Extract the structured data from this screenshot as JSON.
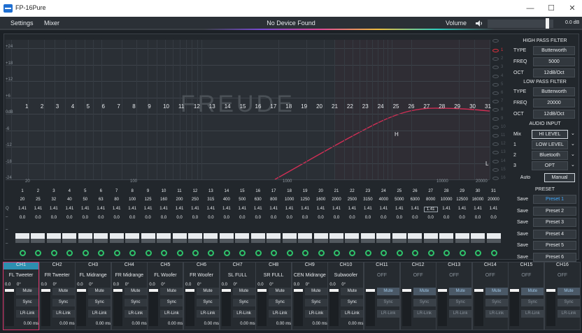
{
  "window": {
    "title": "FP-16Pure",
    "minimize": "—",
    "maximize": "☐",
    "close": "✕"
  },
  "menu": {
    "settings": "Settings",
    "mixer": "Mixer",
    "status": "No Device Found",
    "volume_label": "Volume",
    "volume_value": "0.0 dB"
  },
  "graph": {
    "ylabels": [
      "+24",
      "+18",
      "+12",
      "+6",
      "0dB",
      "-6",
      "-12",
      "-18",
      "-24"
    ],
    "xlabels": [
      "20",
      "100",
      "1000",
      "10000",
      "20000"
    ],
    "filter_numbers": [
      "1",
      "2",
      "3",
      "4",
      "5",
      "6",
      "7",
      "8",
      "9",
      "10",
      "11",
      "12",
      "13",
      "14",
      "15",
      "16",
      "17",
      "18",
      "19",
      "20",
      "21",
      "22",
      "23",
      "24",
      "25",
      "26",
      "27",
      "28",
      "29",
      "30",
      "31"
    ],
    "watermark": "FREUDE",
    "marker_h": "H",
    "marker_l": "L",
    "eyes": [
      "1",
      "2",
      "3",
      "4",
      "5",
      "6",
      "7",
      "8",
      "9",
      "10",
      "11",
      "12",
      "13",
      "14",
      "15",
      "16"
    ]
  },
  "hpf": {
    "header": "HIGH PASS FILTER",
    "type_label": "TYPE",
    "type": "Butterworth",
    "freq_label": "FREQ",
    "freq": "5000",
    "oct_label": "OCT",
    "oct": "12dB/Oct"
  },
  "lpf": {
    "header": "LOW PASS FILTER",
    "type_label": "TYPE",
    "type": "Butterworth",
    "freq_label": "FREQ",
    "freq": "20000",
    "oct_label": "OCT",
    "oct": "12dB/Oct"
  },
  "audio_input": {
    "header": "AUDIO INPUT",
    "rows": [
      {
        "label": "Mix",
        "value": "HI  LEVEL"
      },
      {
        "label": "1",
        "value": "LOW  LEVEL"
      },
      {
        "label": "2",
        "value": "Bluetooth"
      },
      {
        "label": "3",
        "value": "OPT"
      }
    ],
    "auto": "Auto",
    "manual": "Manual"
  },
  "preset": {
    "header": "PRESET",
    "save": "Save",
    "items": [
      "Preset 1",
      "Preset 2",
      "Preset 3",
      "Preset 4",
      "Preset 5",
      "Preset 6"
    ]
  },
  "eq": {
    "q_label": "Q",
    "dash": "–",
    "bands": [
      "1",
      "2",
      "3",
      "4",
      "5",
      "6",
      "7",
      "8",
      "9",
      "10",
      "11",
      "12",
      "13",
      "14",
      "15",
      "16",
      "17",
      "18",
      "19",
      "20",
      "21",
      "22",
      "23",
      "24",
      "25",
      "26",
      "27",
      "28",
      "29",
      "30",
      "31"
    ],
    "freqs": [
      "20",
      "25",
      "32",
      "40",
      "50",
      "63",
      "80",
      "100",
      "125",
      "160",
      "200",
      "250",
      "315",
      "400",
      "500",
      "630",
      "800",
      "1000",
      "1250",
      "1600",
      "2000",
      "2500",
      "3150",
      "4000",
      "5000",
      "6300",
      "8000",
      "10000",
      "12500",
      "16000",
      "20000"
    ],
    "q": "1.41",
    "gain": "0.0"
  },
  "channels": [
    {
      "ch": "CH1",
      "name": "FL Tweeter",
      "active": true
    },
    {
      "ch": "CH2",
      "name": "FR Tweeter",
      "active": true
    },
    {
      "ch": "CH3",
      "name": "FL Midrange",
      "active": true
    },
    {
      "ch": "CH4",
      "name": "FR Midrange",
      "active": true
    },
    {
      "ch": "CH5",
      "name": "FL Woofer",
      "active": true
    },
    {
      "ch": "CH6",
      "name": "FR Woofer",
      "active": true
    },
    {
      "ch": "CH7",
      "name": "SL FULL",
      "active": true
    },
    {
      "ch": "CH8",
      "name": "SR FULL",
      "active": true
    },
    {
      "ch": "CH9",
      "name": "CEN Midrange",
      "active": true
    },
    {
      "ch": "CH10",
      "name": "Subwoofer",
      "active": true
    },
    {
      "ch": "CH11",
      "name": "OFF",
      "active": false
    },
    {
      "ch": "CH12",
      "name": "OFF",
      "active": false
    },
    {
      "ch": "CH13",
      "name": "OFF",
      "active": false
    },
    {
      "ch": "CH14",
      "name": "OFF",
      "active": false
    },
    {
      "ch": "CH15",
      "name": "OFF",
      "active": false
    },
    {
      "ch": "CH16",
      "name": "OFF",
      "active": false
    }
  ],
  "strip": {
    "gain": "0.0",
    "phase": "0°",
    "mute": "Mute",
    "sync": "Sync",
    "lrlink": "LR-Link",
    "delay": "0.00 ms"
  },
  "colors": {
    "accent": "#e0303d",
    "blue": "#3fa9ff",
    "green": "#2fc36b",
    "curve": "#d12e55"
  }
}
